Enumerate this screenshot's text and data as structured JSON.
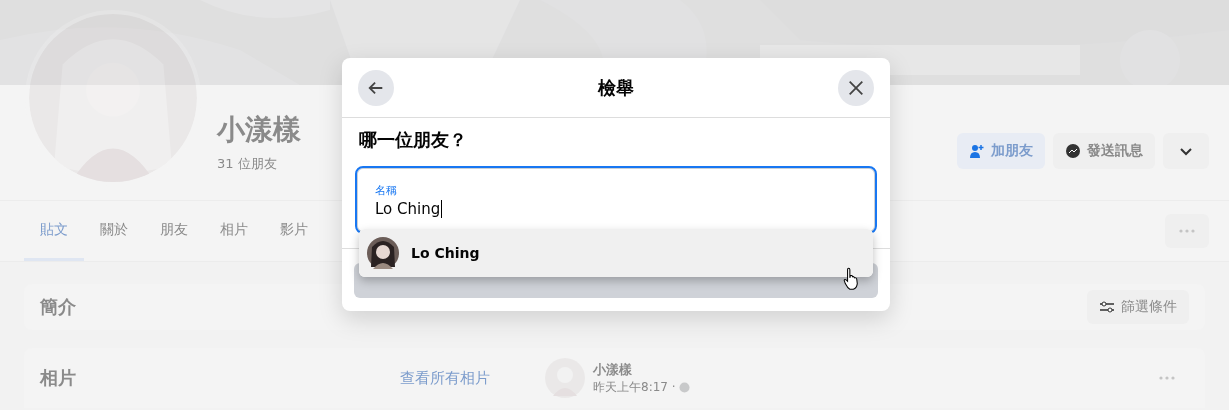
{
  "profile": {
    "name": "小漾樣",
    "friends": "31 位朋友",
    "buttons": [
      {
        "kind": "primary",
        "label": "加朋友"
      },
      {
        "kind": "messenger",
        "label": "發送訊息"
      },
      {
        "kind": "chevron"
      }
    ]
  },
  "tabs": [
    {
      "label": "貼文",
      "selected": true
    },
    {
      "label": "關於",
      "selected": false
    },
    {
      "label": "朋友",
      "selected": false
    },
    {
      "label": "相片",
      "selected": false
    },
    {
      "label": "影片",
      "selected": false
    }
  ],
  "intro": {
    "title": "簡介",
    "filter_button": "篩選條件"
  },
  "photos": {
    "title": "相片",
    "link": "查看所有相片"
  },
  "post": {
    "author": "小漾樣",
    "time": "昨天上午8:17 ·"
  },
  "dialog": {
    "title": "檢舉",
    "question": "哪一位朋友？",
    "field": {
      "label": "名稱",
      "value": "Lo Ching"
    },
    "suggestions": [
      {
        "name": "Lo Ching",
        "selected": true
      }
    ]
  }
}
